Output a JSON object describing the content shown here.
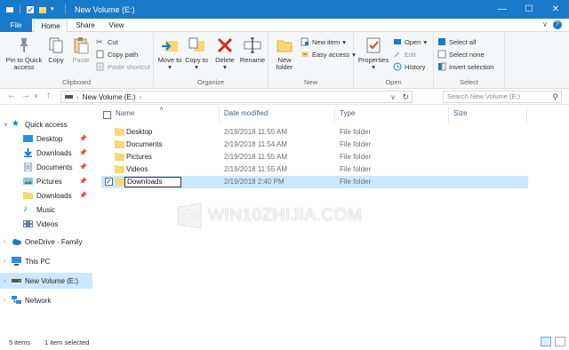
{
  "window": {
    "title": "New Volume (E:)",
    "controls": [
      "minimize-icon",
      "maximize-icon",
      "close-icon"
    ]
  },
  "tabs": {
    "file": "File",
    "home": "Home",
    "share": "Share",
    "view": "View"
  },
  "ribbon": {
    "clipboard": {
      "label": "Clipboard",
      "pin": "Pin to Quick access",
      "copy": "Copy",
      "paste": "Paste",
      "cut": "Cut",
      "copy_path": "Copy path",
      "paste_shortcut": "Paste shortcut"
    },
    "organize": {
      "label": "Organize",
      "move_to": "Move to",
      "copy_to": "Copy to",
      "delete": "Delete",
      "rename": "Rename"
    },
    "new": {
      "label": "New",
      "new_folder": "New folder",
      "new_item": "New item",
      "easy_access": "Easy access"
    },
    "open": {
      "label": "Open",
      "properties": "Properties",
      "open": "Open",
      "edit": "Edit",
      "history": "History"
    },
    "select": {
      "label": "Select",
      "select_all": "Select all",
      "select_none": "Select none",
      "invert": "Invert selection"
    }
  },
  "address": {
    "path": "New Volume (E:)",
    "search_placeholder": "Search New Volume (E:)"
  },
  "nav": {
    "quick_access": "Quick access",
    "items": [
      {
        "label": "Desktop",
        "pinned": true
      },
      {
        "label": "Downloads",
        "pinned": true
      },
      {
        "label": "Documents",
        "pinned": true
      },
      {
        "label": "Pictures",
        "pinned": true
      },
      {
        "label": "Downloads",
        "pinned": true
      },
      {
        "label": "Music",
        "pinned": false
      },
      {
        "label": "Videos",
        "pinned": false
      }
    ],
    "onedrive": "OneDrive - Family",
    "this_pc": "This PC",
    "volume": "New Volume (E:)",
    "network": "Network"
  },
  "columns": {
    "name": "Name",
    "date": "Date modified",
    "type": "Type",
    "size": "Size"
  },
  "files": [
    {
      "name": "Desktop",
      "date": "2/19/2018 11:55 AM",
      "type": "File folder"
    },
    {
      "name": "Documents",
      "date": "2/19/2018 11:54 AM",
      "type": "File folder"
    },
    {
      "name": "Pictures",
      "date": "2/19/2018 11:55 AM",
      "type": "File folder"
    },
    {
      "name": "Videos",
      "date": "2/19/2018 11:55 AM",
      "type": "File folder"
    },
    {
      "name": "Downloads",
      "date": "2/19/2018 2:40 PM",
      "type": "File folder"
    }
  ],
  "watermark": "WIN10ZHIJIA.COM",
  "status": {
    "items": "5 items",
    "selected": "1 item selected"
  },
  "colors": {
    "accent": "#1979ca",
    "selection": "#cce8ff",
    "folder": "#f8d775"
  }
}
